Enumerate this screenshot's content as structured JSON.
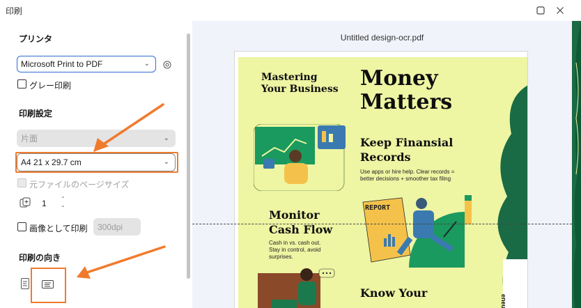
{
  "window": {
    "title": "印刷"
  },
  "printer": {
    "heading": "プリンタ",
    "selected": "Microsoft Print to PDF",
    "grayscale_label": "グレー印刷"
  },
  "settings": {
    "heading": "印刷設定",
    "sides_value": "片面",
    "paper_value": "A4 21 x 29.7 cm",
    "original_size_label": "元ファイルのページサイズ",
    "copies_value": "1",
    "print_as_image_label": "画像として印刷",
    "dpi_value": "300dpi"
  },
  "orientation": {
    "heading": "印刷の向き"
  },
  "preview": {
    "filename": "Untitled design-ocr.pdf",
    "poster": {
      "top_left_title": "Mastering\nYour Business",
      "main_title": "Money\nMatters",
      "h1": "Keep Finansial\nRecords",
      "p1": "Use apps or hire help. Clear records =\nbetter decisions + smoother tax filing",
      "h2": "Monitor\nCash Flow",
      "p2": "Cash in vs. cash out.\nStay in control, avoid\nsurprises.",
      "h3": "Know Your",
      "report_label": "REPORT",
      "side_text": "eneurs"
    }
  },
  "colors": {
    "accent_orange": "#f07a2c",
    "poster_bg": "#eef5a3",
    "poster_green": "#1a7a4e"
  }
}
